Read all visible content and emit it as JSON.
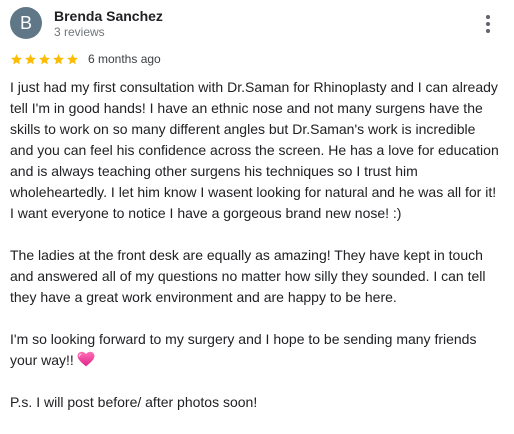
{
  "reviewer": {
    "initial": "B",
    "name": "Brenda Sanchez",
    "review_count": "3 reviews",
    "avatar_color": "#5f7787"
  },
  "menu": {
    "icon": "more-vert-icon"
  },
  "rating": {
    "stars": 5,
    "max_stars": 5,
    "star_color": "#fbbc04",
    "timestamp": "6 months ago"
  },
  "review": {
    "paragraphs": [
      {
        "lines": [
          "I just had my first consultation with Dr.Saman for Rhinoplasty and I can already",
          "tell I'm in good hands! I have an ethnic nose and not many surgens have the",
          "skills to work on so many different angles but Dr.Saman's work is incredible",
          "and you can feel his confidence across the screen. He has a love for education",
          "and is always teaching other surgens his techniques so I trust him",
          "wholeheartedly. I let him know I wasent looking for natural and he was all for it!",
          "I want everyone to notice I have a gorgeous brand new nose! :)"
        ]
      },
      {
        "lines": [
          "The ladies at the front desk are equally as amazing! They have kept in touch",
          "and answered all of my questions no matter how silly they sounded. I can tell",
          "they have a great work environment and are happy to be here."
        ]
      },
      {
        "lines": [
          "I'm so looking forward to my surgery and I hope to be sending many friends",
          "your way!!"
        ],
        "trailing_emoji": "heart-emoji-icon"
      },
      {
        "lines": [
          "P.s. I will post before/ after photos soon!"
        ]
      }
    ]
  }
}
